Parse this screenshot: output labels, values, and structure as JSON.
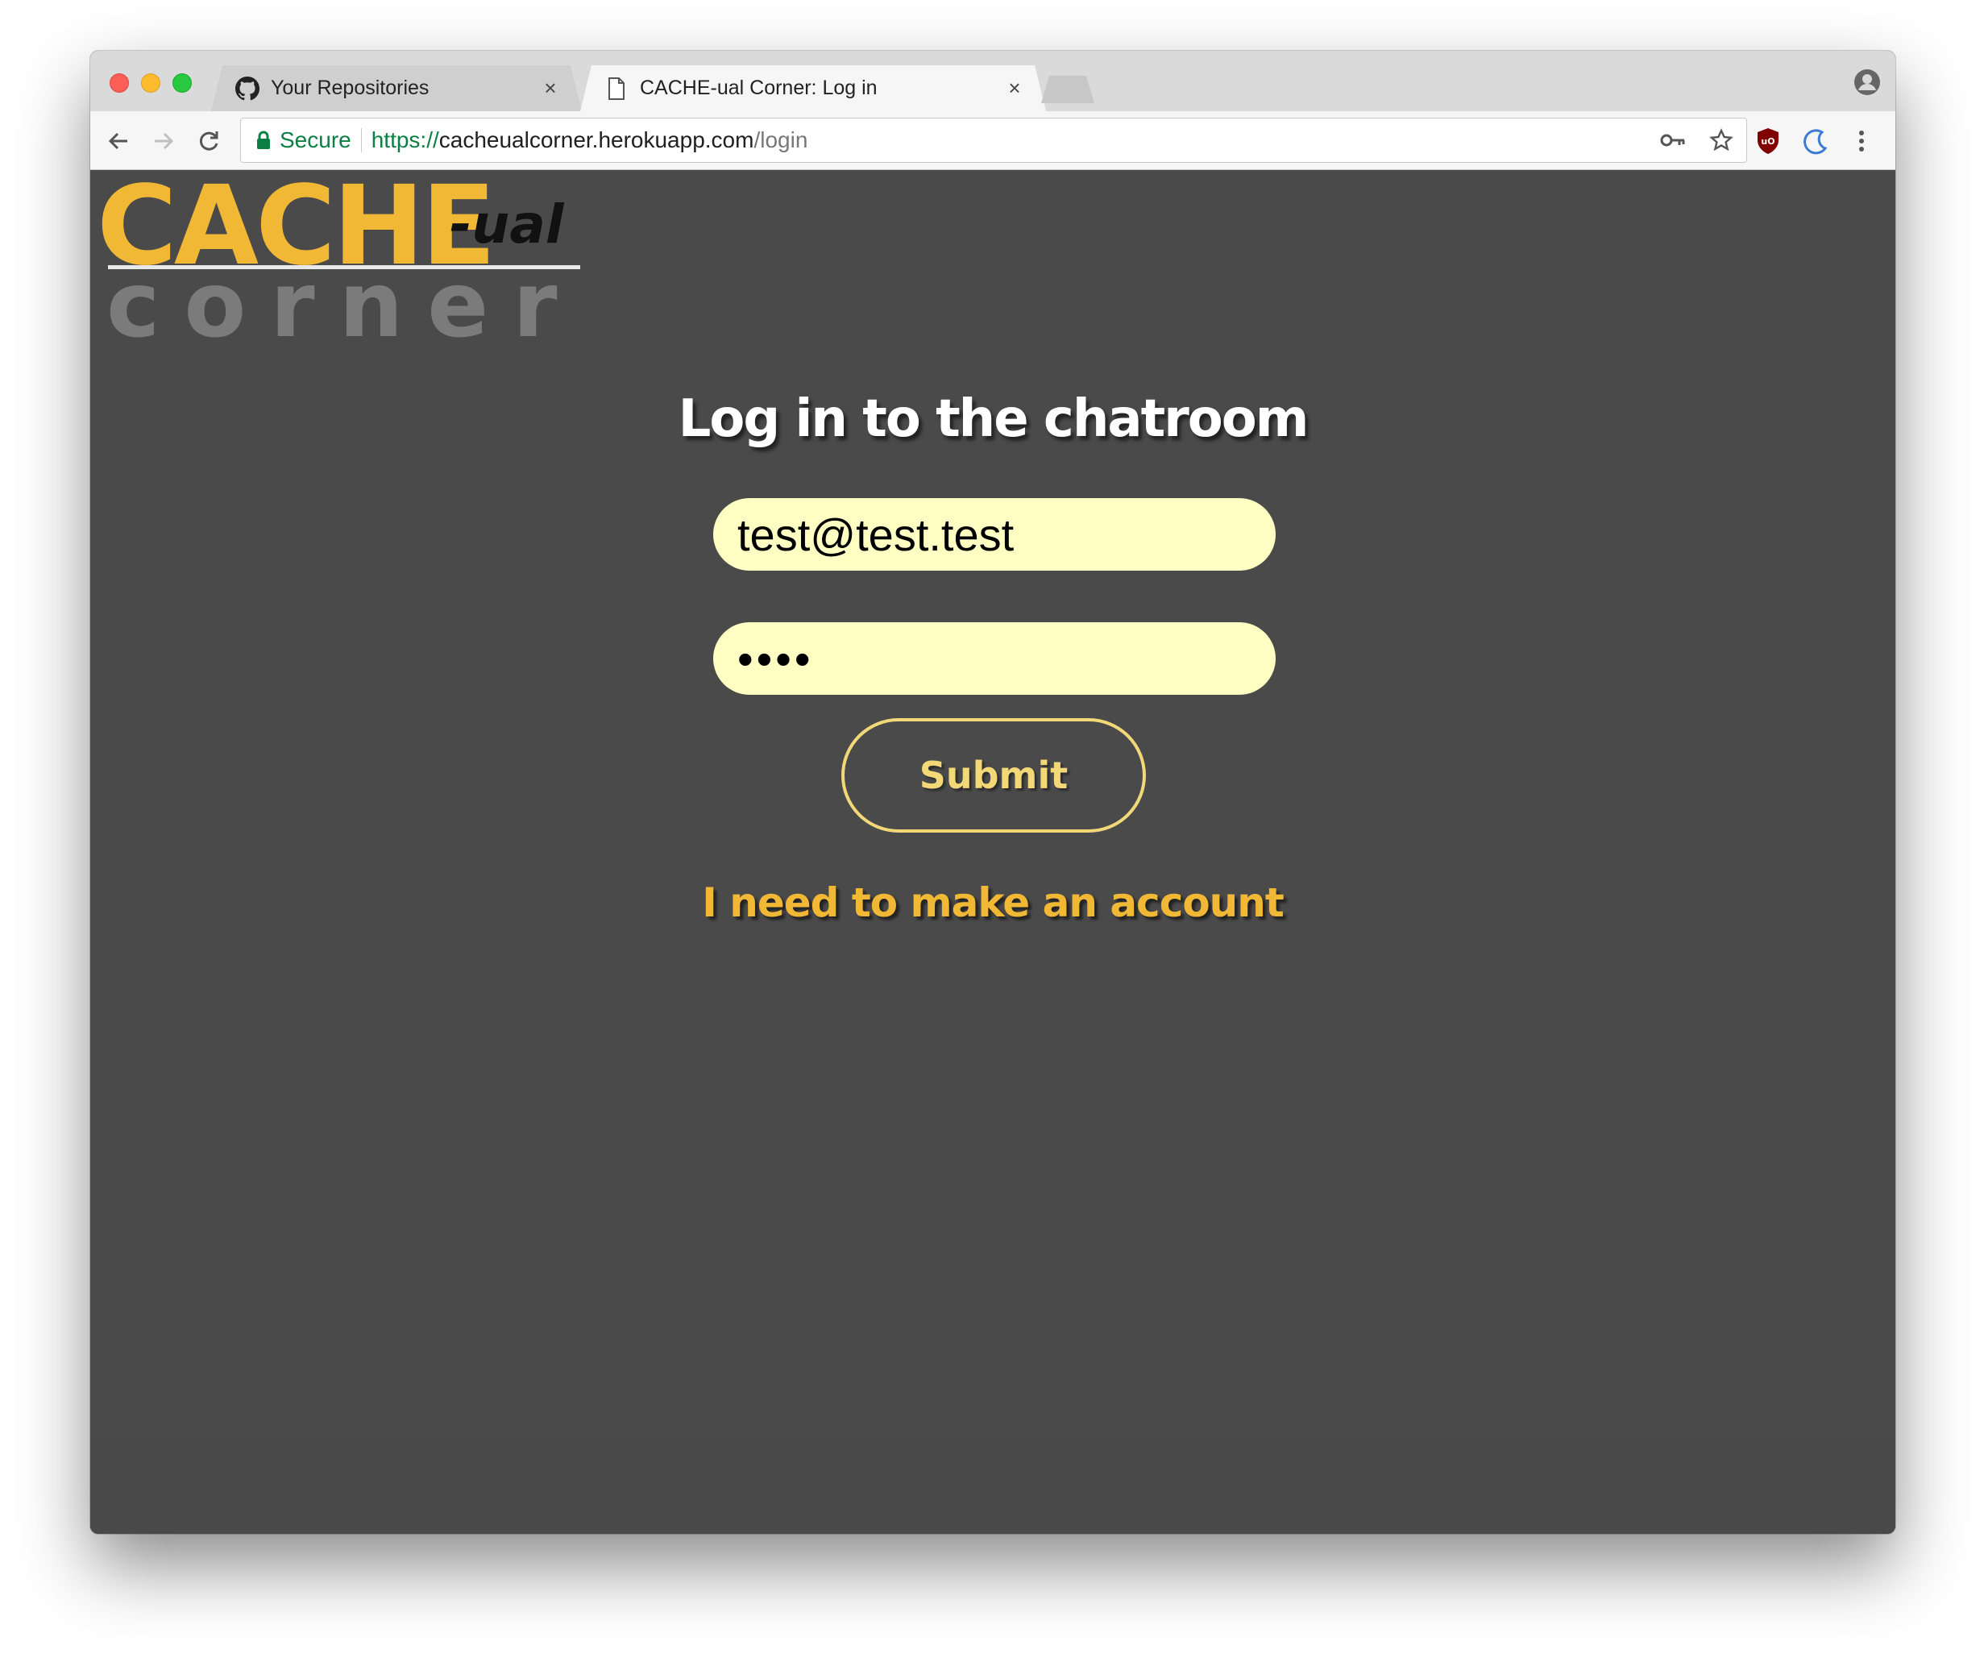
{
  "browser": {
    "tabs": [
      {
        "title": "Your Repositories",
        "icon": "github-icon",
        "active": false
      },
      {
        "title": "CACHE-ual Corner: Log in",
        "icon": "page-icon",
        "active": true
      }
    ],
    "close_glyph": "×",
    "address": {
      "secure_label": "Secure",
      "scheme": "https://",
      "host": "cacheualcorner.herokuapp.com",
      "path": "/login"
    }
  },
  "logo": {
    "cache": "CACHE",
    "ual": "-ual",
    "corner": "corner"
  },
  "login": {
    "title": "Log in to the chatroom",
    "email_value": "test@test.test",
    "password_value": "••••",
    "submit_label": "Submit",
    "account_link": "I need to make an account"
  },
  "colors": {
    "background": "#4a4a4a",
    "accent": "#f1b835",
    "input_bg": "#ffffc3",
    "button_border": "#f3d878"
  }
}
